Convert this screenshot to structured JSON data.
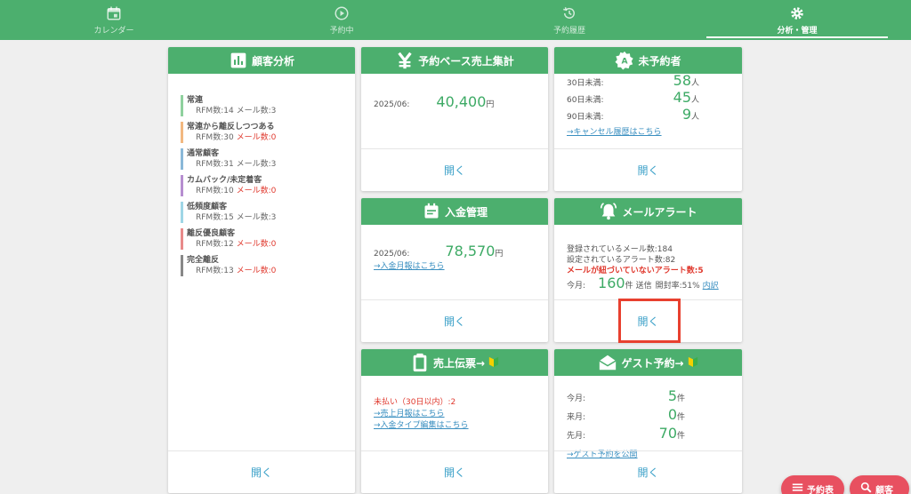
{
  "nav": [
    {
      "label": "カレンダー",
      "icon": "calendar-icon"
    },
    {
      "label": "予約中",
      "icon": "play-circle-icon"
    },
    {
      "label": "予約履歴",
      "icon": "history-icon"
    },
    {
      "label": "分析・管理",
      "icon": "gear-icon",
      "active": true
    }
  ],
  "open_label": "開く",
  "customer_analysis": {
    "title": "顧客分析",
    "segments": [
      {
        "name": "常連",
        "rfm": "RFM数:14",
        "mail": "メール数:3",
        "mail_zero": false,
        "color": "#8fd19e"
      },
      {
        "name": "常連から離反しつつある",
        "rfm": "RFM数:30",
        "mail": "メール数:0",
        "mail_zero": true,
        "color": "#f2b880"
      },
      {
        "name": "通常顧客",
        "rfm": "RFM数:31",
        "mail": "メール数:3",
        "mail_zero": false,
        "color": "#8ab8d8"
      },
      {
        "name": "カムバック/未定着客",
        "rfm": "RFM数:10",
        "mail": "メール数:0",
        "mail_zero": true,
        "color": "#b68ed0"
      },
      {
        "name": "低頻度顧客",
        "rfm": "RFM数:15",
        "mail": "メール数:3",
        "mail_zero": false,
        "color": "#9fd6e6"
      },
      {
        "name": "離反優良顧客",
        "rfm": "RFM数:12",
        "mail": "メール数:0",
        "mail_zero": true,
        "color": "#e88a8a"
      },
      {
        "name": "完全離反",
        "rfm": "RFM数:13",
        "mail": "メール数:0",
        "mail_zero": true,
        "color": "#888888"
      }
    ]
  },
  "sales_summary": {
    "title": "予約ベース売上集計",
    "period": "2025/06:",
    "amount": "40,400",
    "unit": "円"
  },
  "no_booking": {
    "title": "未予約者",
    "rows": [
      {
        "label": "30日未満:",
        "value": "58",
        "unit": "人"
      },
      {
        "label": "60日未満:",
        "value": "45",
        "unit": "人"
      },
      {
        "label": "90日未満:",
        "value": "9",
        "unit": "人"
      }
    ],
    "link": "→キャンセル履歴はこちら"
  },
  "payment": {
    "title": "入金管理",
    "period": "2025/06:",
    "amount": "78,570",
    "unit": "円",
    "link": "→入金月報はこちら"
  },
  "mail_alert": {
    "title": "メールアラート",
    "registered": "登録されているメール数:184",
    "alerts": "設定されているアラート数:82",
    "unlinked": "メールが紐づいていないアラート数:5",
    "month_label": "今月:",
    "month_value": "160",
    "month_unit": "件",
    "sent": "送信",
    "open_rate": "開封率:51%",
    "breakdown": "内訳"
  },
  "sales_slip": {
    "title": "売上伝票→",
    "unpaid": "未払い（30日以内）:2",
    "link1": "→売上月報はこちら",
    "link2": "→入金タイプ編集はこちら"
  },
  "guest_booking": {
    "title": "ゲスト予約→",
    "rows": [
      {
        "label": "今月:",
        "value": "5",
        "unit": "件"
      },
      {
        "label": "来月:",
        "value": "0",
        "unit": "件"
      },
      {
        "label": "先月:",
        "value": "70",
        "unit": "件"
      }
    ],
    "link": "→ゲスト予約を公開"
  },
  "fab": {
    "schedule": "予約表",
    "customer": "顧客"
  },
  "colors": {
    "primary": "#4caf6e",
    "accent_number": "#3daa65",
    "link": "#3a8fc0",
    "warning": "#e03a2f",
    "highlight": "#e8402f",
    "fab": "#e85060"
  }
}
